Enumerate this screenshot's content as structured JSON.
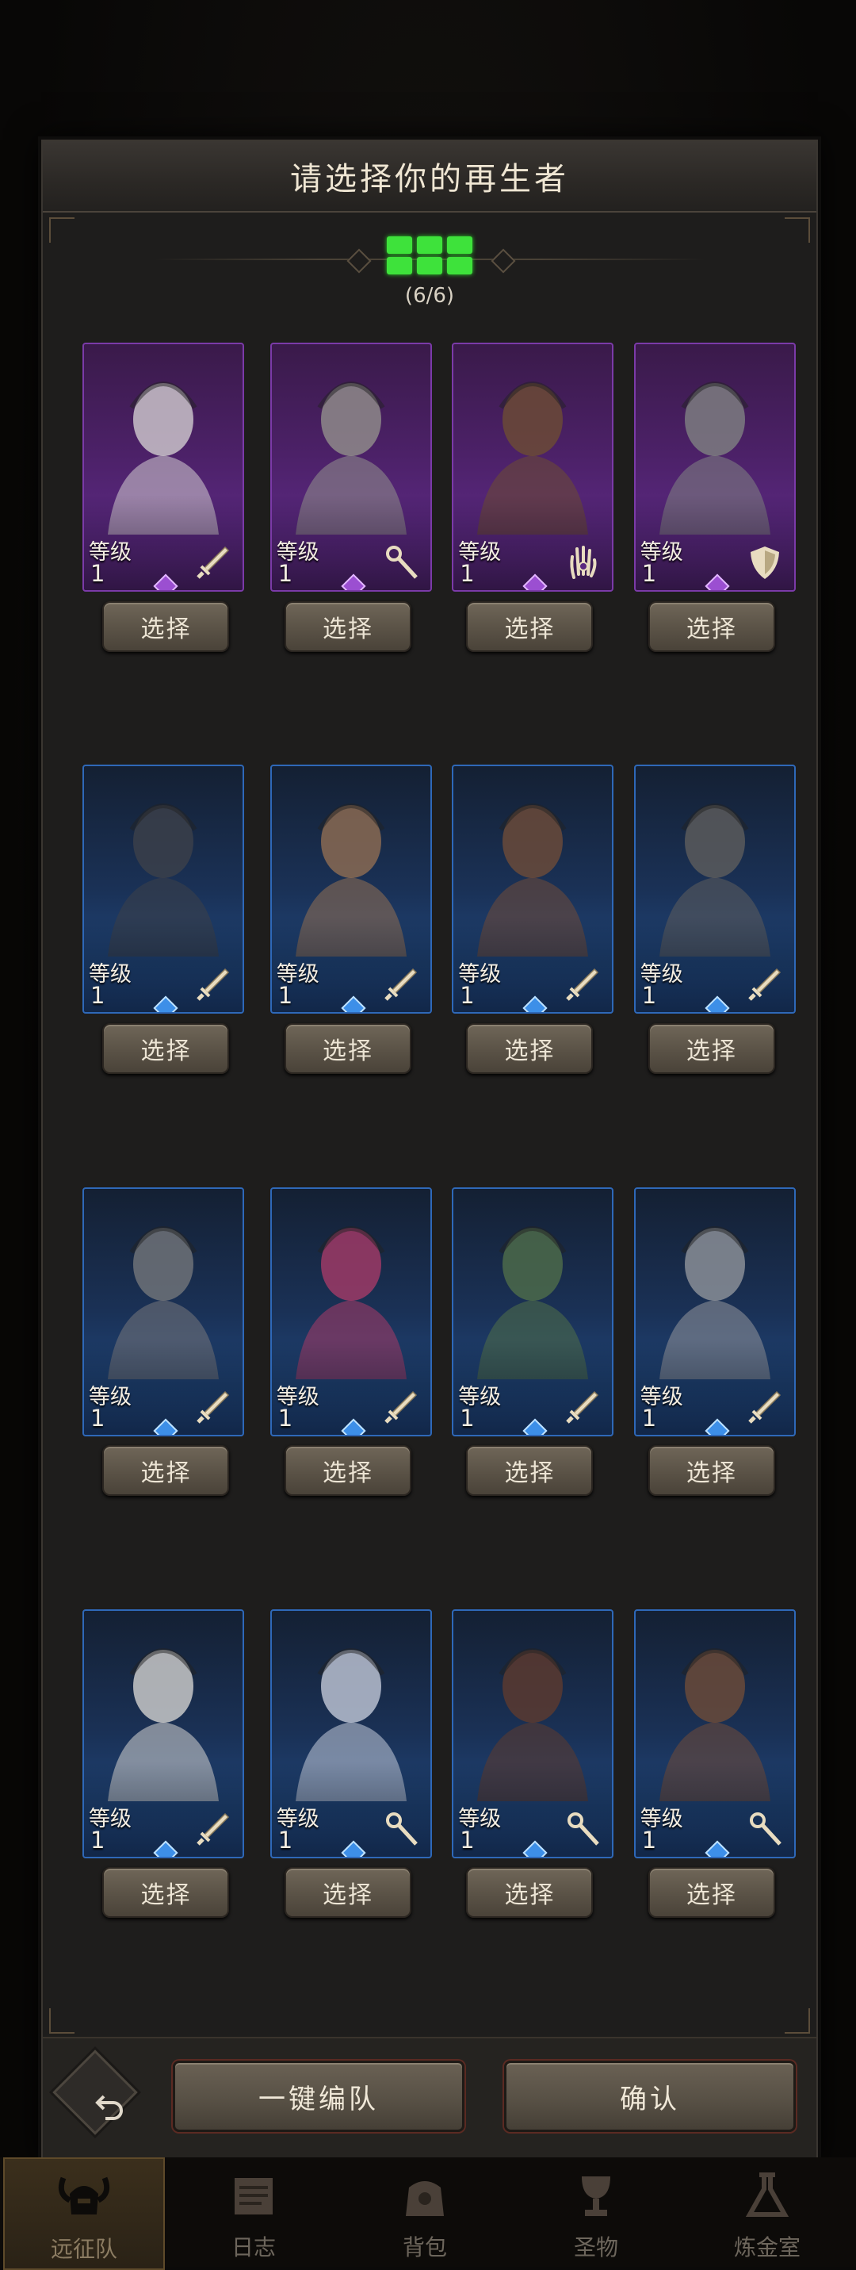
{
  "dialog": {
    "title": "请选择你的再生者",
    "slot_count": "(6/6)",
    "slots_filled": 6,
    "slots_total": 6
  },
  "colors": {
    "purple_rarity": "#6a2f96",
    "blue_rarity": "#2756a0",
    "slot_green": "#3ee23b"
  },
  "heroes": [
    {
      "rarity": "purple",
      "level_label": "等级",
      "level": "1",
      "class_icon": "sword-icon",
      "select_label": "选择"
    },
    {
      "rarity": "purple",
      "level_label": "等级",
      "level": "1",
      "class_icon": "staff-icon",
      "select_label": "选择"
    },
    {
      "rarity": "purple",
      "level_label": "等级",
      "level": "1",
      "class_icon": "hand-icon",
      "select_label": "选择"
    },
    {
      "rarity": "purple",
      "level_label": "等级",
      "level": "1",
      "class_icon": "shield-icon",
      "select_label": "选择"
    },
    {
      "rarity": "blue",
      "level_label": "等级",
      "level": "1",
      "class_icon": "sword-icon",
      "select_label": "选择"
    },
    {
      "rarity": "blue",
      "level_label": "等级",
      "level": "1",
      "class_icon": "sword-icon",
      "select_label": "选择"
    },
    {
      "rarity": "blue",
      "level_label": "等级",
      "level": "1",
      "class_icon": "sword-icon",
      "select_label": "选择"
    },
    {
      "rarity": "blue",
      "level_label": "等级",
      "level": "1",
      "class_icon": "sword-icon",
      "select_label": "选择"
    },
    {
      "rarity": "blue",
      "level_label": "等级",
      "level": "1",
      "class_icon": "sword-icon",
      "select_label": "选择"
    },
    {
      "rarity": "blue",
      "level_label": "等级",
      "level": "1",
      "class_icon": "sword-icon",
      "select_label": "选择"
    },
    {
      "rarity": "blue",
      "level_label": "等级",
      "level": "1",
      "class_icon": "sword-icon",
      "select_label": "选择"
    },
    {
      "rarity": "blue",
      "level_label": "等级",
      "level": "1",
      "class_icon": "sword-icon",
      "select_label": "选择"
    },
    {
      "rarity": "blue",
      "level_label": "等级",
      "level": "1",
      "class_icon": "sword-icon",
      "select_label": "选择"
    },
    {
      "rarity": "blue",
      "level_label": "等级",
      "level": "1",
      "class_icon": "staff-icon",
      "select_label": "选择"
    },
    {
      "rarity": "blue",
      "level_label": "等级",
      "level": "1",
      "class_icon": "staff-icon",
      "select_label": "选择"
    },
    {
      "rarity": "blue",
      "level_label": "等级",
      "level": "1",
      "class_icon": "staff-icon",
      "select_label": "选择"
    }
  ],
  "bottom_bar": {
    "back_icon": "undo-icon",
    "auto_team_label": "一键编队",
    "confirm_label": "确认"
  },
  "nav": [
    {
      "label": "远征队",
      "icon": "horned-helmet-icon",
      "active": true
    },
    {
      "label": "日志",
      "icon": "scroll-icon",
      "active": false
    },
    {
      "label": "背包",
      "icon": "bag-icon",
      "active": false
    },
    {
      "label": "圣物",
      "icon": "chalice-icon",
      "active": false
    },
    {
      "label": "炼金室",
      "icon": "alchemy-icon",
      "active": false
    }
  ]
}
